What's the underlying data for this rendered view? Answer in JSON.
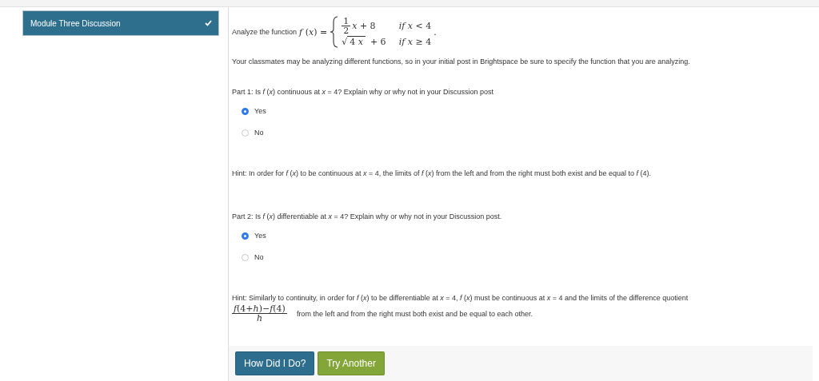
{
  "sidebar": {
    "items": [
      {
        "label": "Module Three Discussion",
        "selected": true,
        "completed": true
      }
    ]
  },
  "question": {
    "intro": "Analyze the function",
    "lhs": "*f* (*x*) =",
    "cases": [
      {
        "kind": "fraction",
        "numerator": "1",
        "denominator": "2",
        "rest": "*x* + 8",
        "condition": "*if  x* < 4"
      },
      {
        "kind": "root",
        "sign": "√",
        "radicand": "4 *x*",
        "rest": "+ 6",
        "condition": "*if  x* ≥ 4"
      }
    ],
    "end": "."
  },
  "note": "Your classmates may be analyzing different functions, so in your initial post in Brightspace be sure to specify the function that you are analyzing.",
  "parts": [
    {
      "prompt": "Part 1: Is *f* (*x*) continuous at *x*  =  4? Explain why or why not in your Discussion post",
      "options": [
        {
          "label": "Yes",
          "selected": true
        },
        {
          "label": "No",
          "selected": false
        }
      ],
      "hint": {
        "text": "Hint: In order for *f* (*x*) to be continuous at *x* = 4, the limits of *f* (*x*) from the left and from the right must both exist and be equal to *f* (4)."
      }
    },
    {
      "prompt": "Part 2: Is *f* (*x*) differentiable at *x* = 4? Explain why or why not in your Discussion post.",
      "options": [
        {
          "label": "Yes",
          "selected": true
        },
        {
          "label": "No",
          "selected": false
        }
      ],
      "hint": {
        "text": "Hint: Similarly to continuity, in order for *f* (*x*) to be differentiable at *x* = 4, *f* (*x*) must be continuous at *x* = 4 and the limits of the difference quotient",
        "numerator": "*f*(4+*h*)−*f*(4)",
        "denominator": "*h*",
        "rest": "from the left and from the right must both exist and be equal to each other."
      }
    }
  ],
  "buttons": [
    {
      "label": "How Did I Do?",
      "kind": "primary"
    },
    {
      "label": "Try Another",
      "kind": "secondary"
    }
  ]
}
